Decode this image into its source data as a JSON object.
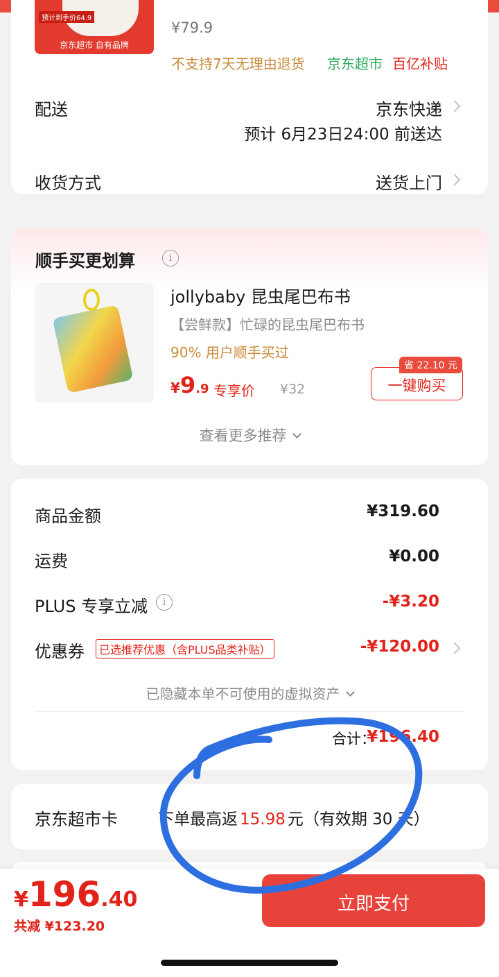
{
  "product": {
    "image_caption_price": "预计到手价64.9",
    "image_caption_brand": "京东超市 自有品牌",
    "price": "¥79.9",
    "tag_no_return": "不支持7天无理由退货",
    "tag_supermarket": "京东超市",
    "tag_subsidy": "百亿补贴"
  },
  "delivery": {
    "label": "配送",
    "method": "京东快递",
    "eta": "预计 6月23日24:00 前送达"
  },
  "receive": {
    "label": "收货方式",
    "value": "送货上门"
  },
  "bundle": {
    "title": "顺手买更划算",
    "item_title": "jollybaby 昆虫尾巴布书",
    "item_subtitle": "【尝鲜款】忙碌的昆虫尾巴布书",
    "item_buyers": "90% 用户顺手买过",
    "price_symbol": "¥",
    "price_int": "9",
    "price_dec": ".9",
    "price_label": "专享价",
    "original_price": "¥32",
    "save_badge": "省 22.10 元",
    "buy_button": "一键购买",
    "more": "查看更多推荐"
  },
  "summary": {
    "goods_label": "商品金额",
    "goods_value": "¥319.60",
    "shipping_label": "运费",
    "shipping_value": "¥0.00",
    "plus_label": "PLUS 专享立减",
    "plus_value": "-¥3.20",
    "coupon_label": "优惠券",
    "coupon_tag": "已选推荐优惠（含PLUS品类补贴）",
    "coupon_value": "-¥120.00",
    "hidden_assets": "已隐藏本单不可使用的虚拟资产",
    "total_label": "合计：",
    "total_value": "¥196.40"
  },
  "card": {
    "label": "京东超市卡",
    "text_prefix": "下单最高返",
    "amount": "15.98",
    "text_suffix": "元（有效期 30 天）"
  },
  "footer": {
    "price_symbol": "¥",
    "price_int": "196",
    "price_dec": ".40",
    "saved": "共减 ¥123.20",
    "pay_button": "立即支付"
  },
  "colors": {
    "accent": "#e2231a",
    "pay_button": "#e8433a",
    "annotation_circle": "#2d6fe0",
    "subsidy_red": "#e2231a",
    "supermarket_green": "#2eaa5e",
    "warn_orange": "#c98a3a"
  }
}
